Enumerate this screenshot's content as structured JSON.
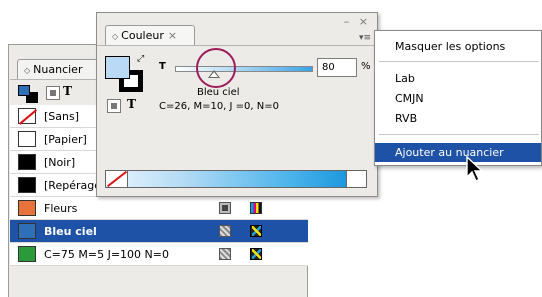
{
  "swatches_panel": {
    "tab_label": "Nuancier",
    "toolbar": {
      "text_icon": "T"
    },
    "items": [
      {
        "name": "[Sans]",
        "chip": "none",
        "icons": [
          "lock-icon",
          "registration-icon"
        ]
      },
      {
        "name": "[Papier]",
        "chip": "#ffffff",
        "icons": []
      },
      {
        "name": "[Noir]",
        "chip": "#000000",
        "icons": []
      },
      {
        "name": "[Repérage]",
        "chip": "#000000",
        "icons": [
          "lock-icon",
          "registration-icon"
        ]
      },
      {
        "name": "Fleurs",
        "chip": "#e8733a",
        "icons": [
          "process-color-icon",
          "cmyk-icon"
        ]
      },
      {
        "name": "Bleu ciel",
        "chip": "#2e6fb7",
        "icons": [
          "tint-icon",
          "mixed-ink-icon"
        ],
        "selected": true
      },
      {
        "name": "C=75 M=5 J=100 N=0",
        "chip": "#2a9a3a",
        "icons": [
          "tint-icon",
          "mixed-ink-icon"
        ]
      }
    ],
    "lock_glyph": "✗",
    "reg_glyph": "⌖"
  },
  "color_panel": {
    "tab_label": "Couleur",
    "tab_close": "×",
    "window_buttons": "– ×",
    "menu_button": "▾≡",
    "tint_label": "T",
    "tint_value": "80",
    "percent": "%",
    "swatch_name": "Bleu ciel",
    "formula": "C=26, M=10, J =0, N=0",
    "text_icon": "T",
    "swap_glyph": "⤢"
  },
  "menu": {
    "items": [
      {
        "label": "Masquer les options"
      },
      {
        "label": "Lab"
      },
      {
        "label": "CMJN"
      },
      {
        "label": "RVB"
      },
      {
        "label": "Ajouter au nuancier",
        "active": true
      }
    ]
  },
  "colors": {
    "selection_blue": "#1d52a6",
    "highlight_circle": "#9e1b5d",
    "fill_color": "#b9d9f4"
  }
}
